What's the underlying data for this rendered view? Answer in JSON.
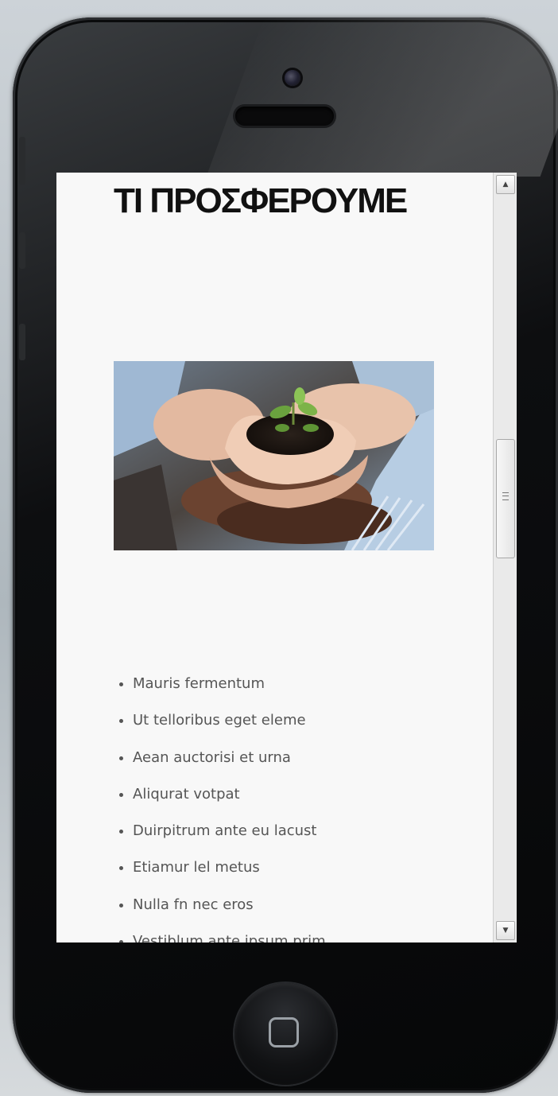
{
  "page": {
    "title": "ΤΙ ΠΡΟΣΦΕΡΟΥΜΕ"
  },
  "features": [
    "Mauris fermentum",
    "Ut telloribus eget eleme",
    "Aean auctorisi et urna",
    "Aliqurat votpat",
    "Duirpitrum ante eu lacust",
    "Etiamur lel metus",
    "Nulla fn nec eros",
    "Vestiblum ante ipsum prim"
  ],
  "hero": {
    "icon": "hands-holding-seedling-image"
  },
  "colors": {
    "screen_bg": "#f8f8f8",
    "title": "#111111",
    "list_text": "#555555",
    "phone_body": "#0d0e10"
  }
}
